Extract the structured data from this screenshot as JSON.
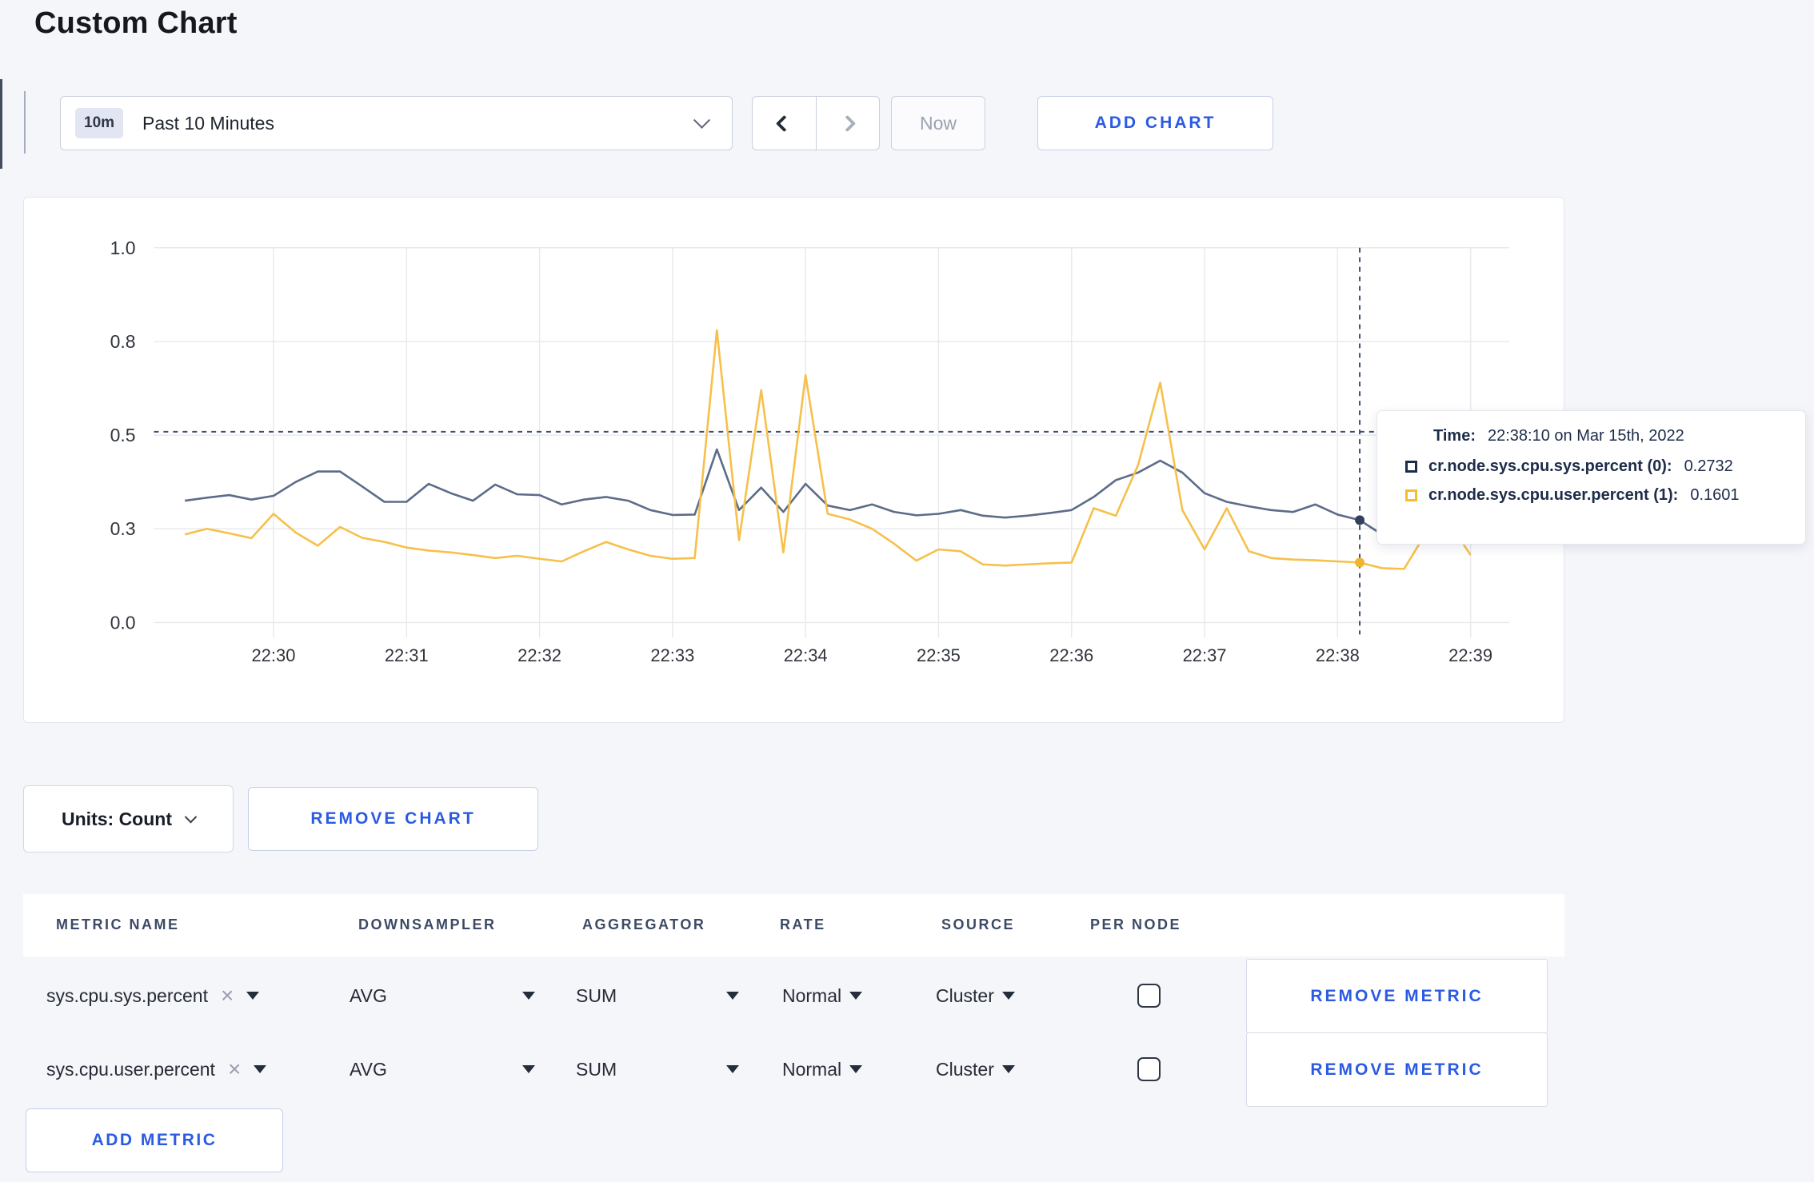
{
  "page": {
    "title": "Custom Chart",
    "background": "#f5f6fa",
    "accent_blue": "#2b5be2"
  },
  "icons": {
    "close_glyph": "×"
  },
  "toolbar": {
    "range_badge": "10m",
    "range_label": "Past 10 Minutes",
    "now_label": "Now",
    "add_chart_label": "ADD CHART"
  },
  "chart_data": {
    "type": "line",
    "title": "Custom Chart",
    "xlabel": "",
    "ylabel": "",
    "ylim": [
      0,
      1
    ],
    "grid": true,
    "x_tick_labels": [
      "22:30",
      "22:31",
      "22:32",
      "22:33",
      "22:34",
      "22:35",
      "22:36",
      "22:37",
      "22:38",
      "22:39"
    ],
    "y_ticks": [
      {
        "label": "0.0",
        "value": 0.0
      },
      {
        "label": "0.3",
        "value": 0.25
      },
      {
        "label": "0.5",
        "value": 0.5
      },
      {
        "label": "0.8",
        "value": 0.75
      },
      {
        "label": "1.0",
        "value": 1.0
      }
    ],
    "x_start": "22:29:20",
    "x_step_seconds": 10,
    "series": [
      {
        "name": "cr.node.sys.cpu.sys.percent",
        "color": "#5c6c89",
        "dot_color": "#33405c",
        "values": [
          0.325,
          0.333,
          0.34,
          0.328,
          0.338,
          0.375,
          0.403,
          0.403,
          0.363,
          0.322,
          0.322,
          0.37,
          0.345,
          0.325,
          0.368,
          0.342,
          0.34,
          0.315,
          0.328,
          0.335,
          0.325,
          0.3,
          0.287,
          0.288,
          0.462,
          0.3,
          0.36,
          0.295,
          0.37,
          0.312,
          0.3,
          0.315,
          0.295,
          0.286,
          0.29,
          0.3,
          0.285,
          0.28,
          0.285,
          0.292,
          0.3,
          0.335,
          0.38,
          0.4,
          0.432,
          0.4,
          0.345,
          0.322,
          0.31,
          0.3,
          0.295,
          0.315,
          0.288,
          0.2732,
          0.235,
          0.27,
          0.28,
          0.275,
          0.28,
          0.285
        ]
      },
      {
        "name": "cr.node.sys.cpu.user.percent",
        "color": "#f6c04a",
        "dot_color": "#f0b42e",
        "values": [
          0.235,
          0.25,
          0.238,
          0.225,
          0.29,
          0.24,
          0.205,
          0.255,
          0.226,
          0.215,
          0.2,
          0.192,
          0.187,
          0.18,
          0.172,
          0.178,
          0.17,
          0.163,
          0.19,
          0.215,
          0.195,
          0.178,
          0.17,
          0.172,
          0.78,
          0.22,
          0.62,
          0.187,
          0.66,
          0.29,
          0.275,
          0.25,
          0.21,
          0.165,
          0.195,
          0.19,
          0.155,
          0.152,
          0.155,
          0.158,
          0.16,
          0.305,
          0.285,
          0.42,
          0.64,
          0.3,
          0.195,
          0.305,
          0.19,
          0.172,
          0.168,
          0.166,
          0.163,
          0.1601,
          0.145,
          0.143,
          0.24,
          0.27,
          0.18
        ]
      }
    ],
    "crosshair": {
      "index": 53,
      "time": "22:38:10",
      "hline_value": 0.509
    },
    "legend_position": "tooltip"
  },
  "tooltip": {
    "time_label": "Time:",
    "time_value": "22:38:10 on Mar 15th, 2022",
    "rows": [
      {
        "name": "cr.node.sys.cpu.sys.percent (0):",
        "value": "0.2732",
        "color": "#1d2c49"
      },
      {
        "name": "cr.node.sys.cpu.user.percent (1):",
        "value": "0.1601",
        "color": "#f5bd31"
      }
    ]
  },
  "chart_controls": {
    "units_label": "Units: Count",
    "remove_chart_label": "REMOVE CHART"
  },
  "metrics_table": {
    "headers": [
      "METRIC NAME",
      "DOWNSAMPLER",
      "AGGREGATOR",
      "RATE",
      "SOURCE",
      "PER NODE"
    ],
    "rows": [
      {
        "metric": "sys.cpu.sys.percent",
        "downsampler": "AVG",
        "aggregator": "SUM",
        "rate": "Normal",
        "source": "Cluster",
        "per_node_checked": false,
        "remove_label": "REMOVE METRIC"
      },
      {
        "metric": "sys.cpu.user.percent",
        "downsampler": "AVG",
        "aggregator": "SUM",
        "rate": "Normal",
        "source": "Cluster",
        "per_node_checked": false,
        "remove_label": "REMOVE METRIC"
      }
    ],
    "add_metric_label": "ADD METRIC"
  }
}
